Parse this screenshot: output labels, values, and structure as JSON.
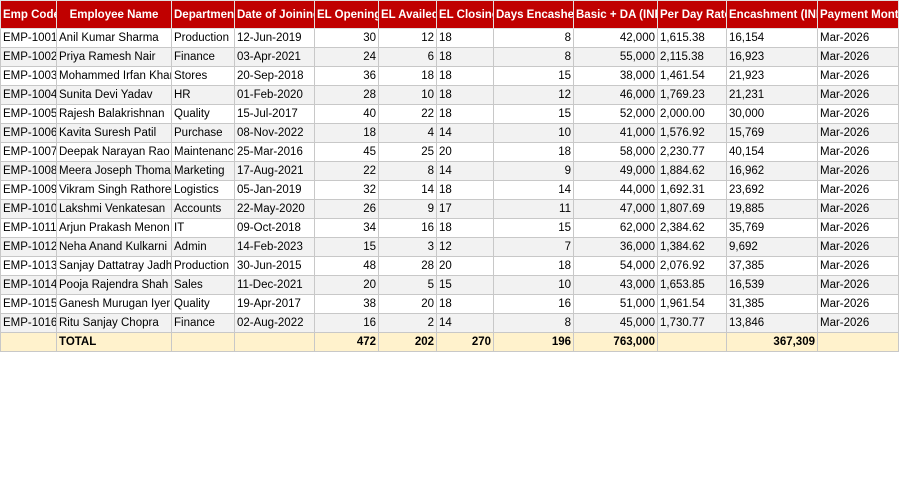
{
  "headers": [
    "Emp Code",
    "Employee Name",
    "Department",
    "Date of Joining",
    "EL Opening",
    "EL Availed",
    "EL Closing",
    "Days Encashed",
    "Basic + DA (INR)",
    "Per Day Rate",
    "Encashment (INR)",
    "Payment Month"
  ],
  "rows": [
    [
      "EMP-1001",
      "Anil Kumar Sharma",
      "Production",
      "12-Jun-2019",
      "30",
      "12",
      "18",
      "8",
      "42,000",
      "1,615.38",
      "16,154",
      "Mar-2026"
    ],
    [
      "EMP-1002",
      "Priya Ramesh Nair",
      "Finance",
      "03-Apr-2021",
      "24",
      "6",
      "18",
      "8",
      "55,000",
      "2,115.38",
      "16,923",
      "Mar-2026"
    ],
    [
      "EMP-1003",
      "Mohammed Irfan Khan",
      "Stores",
      "20-Sep-2018",
      "36",
      "18",
      "18",
      "15",
      "38,000",
      "1,461.54",
      "21,923",
      "Mar-2026"
    ],
    [
      "EMP-1004",
      "Sunita Devi Yadav",
      "HR",
      "01-Feb-2020",
      "28",
      "10",
      "18",
      "12",
      "46,000",
      "1,769.23",
      "21,231",
      "Mar-2026"
    ],
    [
      "EMP-1005",
      "Rajesh Balakrishnan",
      "Quality",
      "15-Jul-2017",
      "40",
      "22",
      "18",
      "15",
      "52,000",
      "2,000.00",
      "30,000",
      "Mar-2026"
    ],
    [
      "EMP-1006",
      "Kavita Suresh Patil",
      "Purchase",
      "08-Nov-2022",
      "18",
      "4",
      "14",
      "10",
      "41,000",
      "1,576.92",
      "15,769",
      "Mar-2026"
    ],
    [
      "EMP-1007",
      "Deepak Narayan Rao",
      "Maintenance",
      "25-Mar-2016",
      "45",
      "25",
      "20",
      "18",
      "58,000",
      "2,230.77",
      "40,154",
      "Mar-2026"
    ],
    [
      "EMP-1008",
      "Meera Joseph Thomas",
      "Marketing",
      "17-Aug-2021",
      "22",
      "8",
      "14",
      "9",
      "49,000",
      "1,884.62",
      "16,962",
      "Mar-2026"
    ],
    [
      "EMP-1009",
      "Vikram Singh Rathore",
      "Logistics",
      "05-Jan-2019",
      "32",
      "14",
      "18",
      "14",
      "44,000",
      "1,692.31",
      "23,692",
      "Mar-2026"
    ],
    [
      "EMP-1010",
      "Lakshmi Venkatesan",
      "Accounts",
      "22-May-2020",
      "26",
      "9",
      "17",
      "11",
      "47,000",
      "1,807.69",
      "19,885",
      "Mar-2026"
    ],
    [
      "EMP-1011",
      "Arjun Prakash Menon",
      "IT",
      "09-Oct-2018",
      "34",
      "16",
      "18",
      "15",
      "62,000",
      "2,384.62",
      "35,769",
      "Mar-2026"
    ],
    [
      "EMP-1012",
      "Neha Anand Kulkarni",
      "Admin",
      "14-Feb-2023",
      "15",
      "3",
      "12",
      "7",
      "36,000",
      "1,384.62",
      "9,692",
      "Mar-2026"
    ],
    [
      "EMP-1013",
      "Sanjay Dattatray Jadhav",
      "Production",
      "30-Jun-2015",
      "48",
      "28",
      "20",
      "18",
      "54,000",
      "2,076.92",
      "37,385",
      "Mar-2026"
    ],
    [
      "EMP-1014",
      "Pooja Rajendra Shah",
      "Sales",
      "11-Dec-2021",
      "20",
      "5",
      "15",
      "10",
      "43,000",
      "1,653.85",
      "16,539",
      "Mar-2026"
    ],
    [
      "EMP-1015",
      "Ganesh Murugan Iyer",
      "Quality",
      "19-Apr-2017",
      "38",
      "20",
      "18",
      "16",
      "51,000",
      "1,961.54",
      "31,385",
      "Mar-2026"
    ],
    [
      "EMP-1016",
      "Ritu Sanjay Chopra",
      "Finance",
      "02-Aug-2022",
      "16",
      "2",
      "14",
      "8",
      "45,000",
      "1,730.77",
      "13,846",
      "Mar-2026"
    ]
  ],
  "total": {
    "label": "TOTAL",
    "el_opening": "472",
    "el_availed": "202",
    "el_closing": "270",
    "days_encashed": "196",
    "basic_da": "763,000",
    "encashment": "367,309"
  },
  "colors": {
    "header_bg": "#c00000",
    "header_text": "#ffffff",
    "total_bg": "#fff2cc",
    "stripe_bg": "#f2f2f2"
  }
}
